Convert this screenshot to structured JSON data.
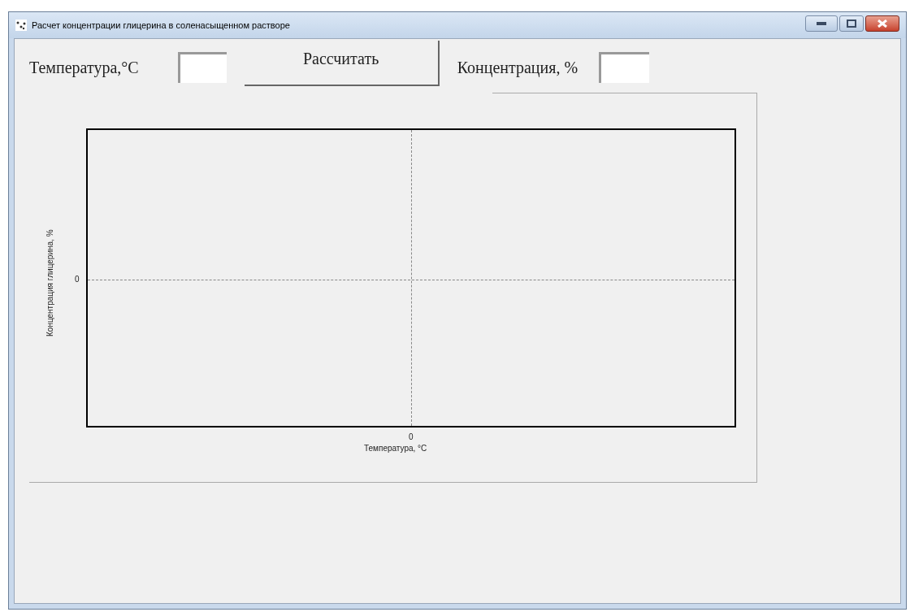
{
  "window": {
    "title": "Расчет концентрации глицерина в соленасыщенном растворе"
  },
  "controls": {
    "temperature_label": "Температура,°С",
    "calculate_button": "Рассчитать",
    "concentration_label": "Концентрация, %"
  },
  "plot": {
    "ylabel": "Концентрация глицерина, %",
    "xlabel": "Температура, °С",
    "y_tick": "0",
    "x_tick": "0"
  }
}
